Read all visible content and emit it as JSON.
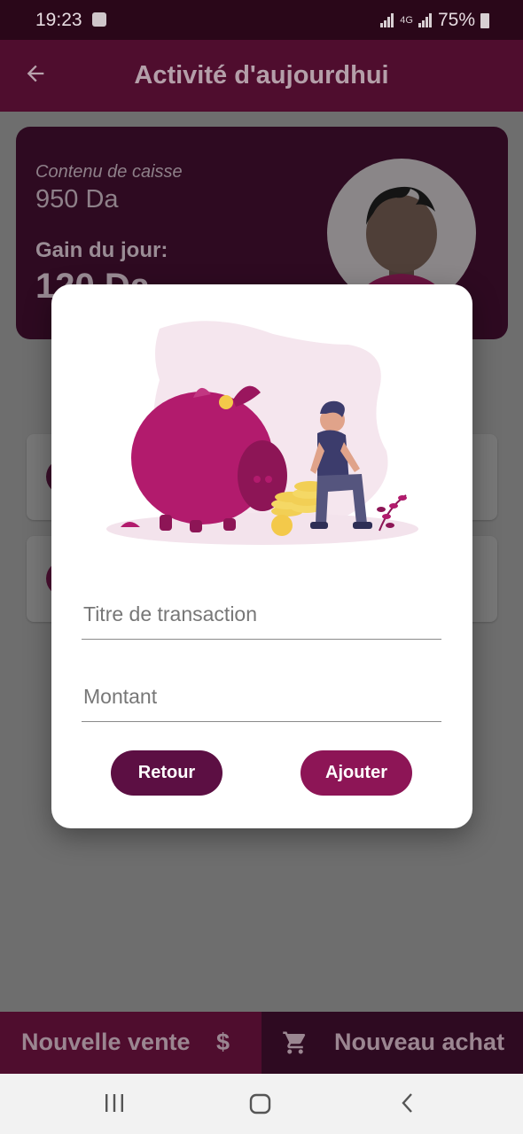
{
  "status_bar": {
    "time": "19:23",
    "network": "4G",
    "battery": "75%"
  },
  "app_bar": {
    "back_icon": "arrow-left-icon",
    "title": "Activité d'aujourdhui"
  },
  "summary": {
    "cash_label": "Contenu de caisse",
    "cash_value": "950 Da",
    "gain_label": "Gain du jour:",
    "gain_value": "120 Da"
  },
  "dialog": {
    "illustration": "piggy-bank-savings-illustration",
    "title_field": {
      "placeholder": "Titre de transaction",
      "value": ""
    },
    "amount_field": {
      "placeholder": "Montant",
      "value": ""
    },
    "cancel_label": "Retour",
    "add_label": "Ajouter",
    "colors": {
      "cancel": "#5c0f43",
      "add": "#8d1556",
      "illustration_accent": "#b21b6d"
    }
  },
  "bottom_bar": {
    "sale_label": "Nouvelle vente",
    "sale_icon": "dollar-icon",
    "sale_symbol": "$",
    "purchase_label": "Nouveau achat",
    "purchase_icon": "cart-icon"
  },
  "nav_bar": {
    "recents_icon": "recents-icon",
    "home_icon": "home-icon",
    "back_icon": "back-icon"
  },
  "colors": {
    "primary": "#4f0d2e",
    "primary_dark": "#2e0a21",
    "scrim": "#6e6e6e"
  }
}
